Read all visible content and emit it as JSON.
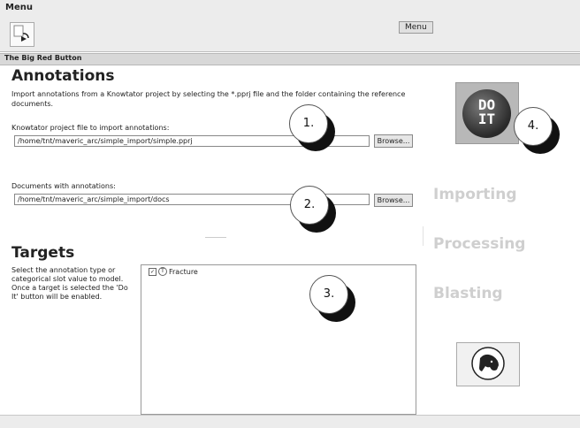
{
  "menubar": {
    "title": "Menu",
    "menu_button": "Menu",
    "toolbar_icon": "run-config-icon"
  },
  "panel": {
    "title": "The Big Red Button"
  },
  "annotations": {
    "heading": "Annotations",
    "description": "Import annotations from a Knowtator project by selecting the *.pprj file and the folder containing the reference documents.",
    "project_label": "Knowtator project file to import annotations:",
    "project_value": "/home/tnt/maveric_arc/simple_import/simple.pprj",
    "docs_label": "Documents with annotations:",
    "docs_value": "/home/tnt/maveric_arc/simple_import/docs",
    "browse_label": "Browse..."
  },
  "targets": {
    "heading": "Targets",
    "description": "Select the annotation type or categorical slot value to model. Once a target is selected the 'Do It' button will be enabled.",
    "items": [
      {
        "label": "Fracture",
        "checked": true,
        "type_icon": "T"
      }
    ]
  },
  "doit": {
    "line1": "DO",
    "line2": "IT"
  },
  "status": {
    "importing": "Importing",
    "processing": "Processing",
    "blasting": "Blasting"
  },
  "callouts": [
    "1.",
    "2.",
    "3.",
    "4."
  ],
  "icons": {
    "dog": "dog-head-icon"
  },
  "colors": {
    "doit_dark": "#2a2a2a",
    "status_inactive": "#cfcfcf"
  }
}
